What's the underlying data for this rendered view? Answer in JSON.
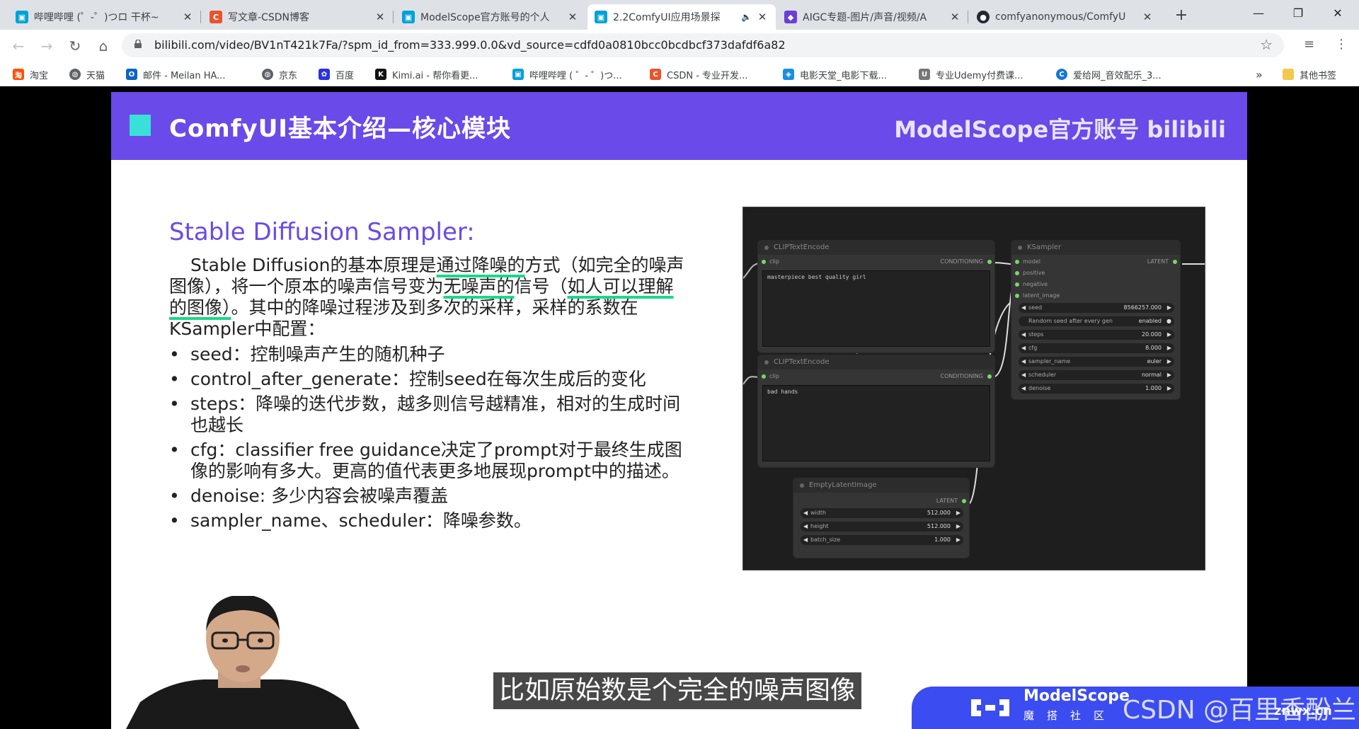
{
  "tabs": [
    {
      "title": "哔哩哔哩 (゜-゜)つロ 干杯~",
      "favicon": "bilibili-icon",
      "active": false
    },
    {
      "title": "写文章-CSDN博客",
      "favicon": "csdn-icon",
      "active": false
    },
    {
      "title": "ModelScope官方账号的个人",
      "favicon": "bilibili-icon",
      "active": false
    },
    {
      "title": "2.2ComfyUI应用场景探",
      "favicon": "bilibili-icon",
      "active": true
    },
    {
      "title": "AIGC专题-图片/声音/视频/A",
      "favicon": "aigc-icon",
      "active": false
    },
    {
      "title": "comfyanonymous/ComfyU",
      "favicon": "github-icon",
      "active": false
    }
  ],
  "address_bar": {
    "url": "bilibili.com/video/BV1nT421k7Fa/?spm_id_from=333.999.0.0&vd_source=cdfd0a0810bcc0bcdbcf373dafdf6a82"
  },
  "bookmarks": [
    {
      "label": "淘宝",
      "icon": "taobao-icon"
    },
    {
      "label": "天猫",
      "icon": "globe-icon"
    },
    {
      "label": "邮件 - Meilan HA...",
      "icon": "outlook-icon"
    },
    {
      "label": "京东",
      "icon": "globe-icon"
    },
    {
      "label": "百度",
      "icon": "baidu-icon"
    },
    {
      "label": "Kimi.ai - 帮你看更...",
      "icon": "kimi-icon"
    },
    {
      "label": "哔哩哔哩 ( ゜- ゜)つ...",
      "icon": "bilibili-icon"
    },
    {
      "label": "CSDN - 专业开发...",
      "icon": "csdn-icon"
    },
    {
      "label": "电影天堂_电影下载...",
      "icon": "shield-icon"
    },
    {
      "label": "专业Udemy付费课...",
      "icon": "udemy-icon"
    },
    {
      "label": "爱给网_音效配乐_3...",
      "icon": "aigei-icon"
    }
  ],
  "bookmarks_overflow": "»",
  "other_bookmarks": "其他书签",
  "slide": {
    "header_title": "ComfyUI基本介绍—核心模块",
    "header_brand": "ModelScope官方账号 bilibili",
    "section_title": "Stable Diffusion Sampler:",
    "intro_1": "Stable Diffusion的基本原理是",
    "intro_u1": "通过降噪的",
    "intro_2": "方式（如完全的噪声图像），将一个原本的噪声信号变为",
    "intro_u2": "无噪声的",
    "intro_3": "信号（",
    "intro_u3": "如人可以理解的图像）",
    "intro_4": "。其中的降噪过程涉及到多次的采样，采样的系数在KSampler中配置：",
    "bullets": [
      "seed：控制噪声产生的随机种子",
      "control_after_generate：控制seed在每次生成后的变化",
      "steps：降噪的迭代步数，越多则信号越精准，相对的生成时间也越长",
      "cfg：classifier free guidance决定了prompt对于最终生成图像的影响有多大。更高的值代表更多地展现prompt中的描述。",
      "denoise: 多少内容会被噪声覆盖",
      "sampler_name、scheduler：降噪参数。"
    ]
  },
  "graph": {
    "clip1_title": "CLIPTextEncode",
    "clip1_in": "clip",
    "clip1_out": "CONDITIONING",
    "clip1_text": "masterpiece best quality girl",
    "clip2_title": "CLIPTextEncode",
    "clip2_in": "clip",
    "clip2_out": "CONDITIONING",
    "clip2_text": "bad hands",
    "ks_title": "KSampler",
    "ks_out": "LATENT",
    "ks_inputs": [
      "model",
      "positive",
      "negative",
      "latent_image"
    ],
    "ks_widgets": [
      {
        "label": "seed",
        "value": "8566257.000"
      },
      {
        "label": "Random seed after every gen",
        "value": "enabled"
      },
      {
        "label": "steps",
        "value": "20.000"
      },
      {
        "label": "cfg",
        "value": "8.000"
      },
      {
        "label": "sampler_name",
        "value": "euler"
      },
      {
        "label": "scheduler",
        "value": "normal"
      },
      {
        "label": "denoise",
        "value": "1.000"
      }
    ],
    "latent_title": "EmptyLatentImage",
    "latent_out": "LATENT",
    "latent_widgets": [
      {
        "label": "width",
        "value": "512.000"
      },
      {
        "label": "height",
        "value": "512.000"
      },
      {
        "label": "batch_size",
        "value": "1.000"
      }
    ]
  },
  "subtitle": "比如原始数是个完全的噪声图像",
  "modelscope_logo": {
    "name": "ModelScope",
    "cn": "魔搭社区"
  },
  "watermark": "CSDN @百里香酚兰",
  "site_mark": "znwx.cn",
  "colors": {
    "slide_header": "#6a4ae8",
    "accent_square": "#39e0d8",
    "underline": "#1bd889",
    "section_title": "#6a4ae8"
  }
}
